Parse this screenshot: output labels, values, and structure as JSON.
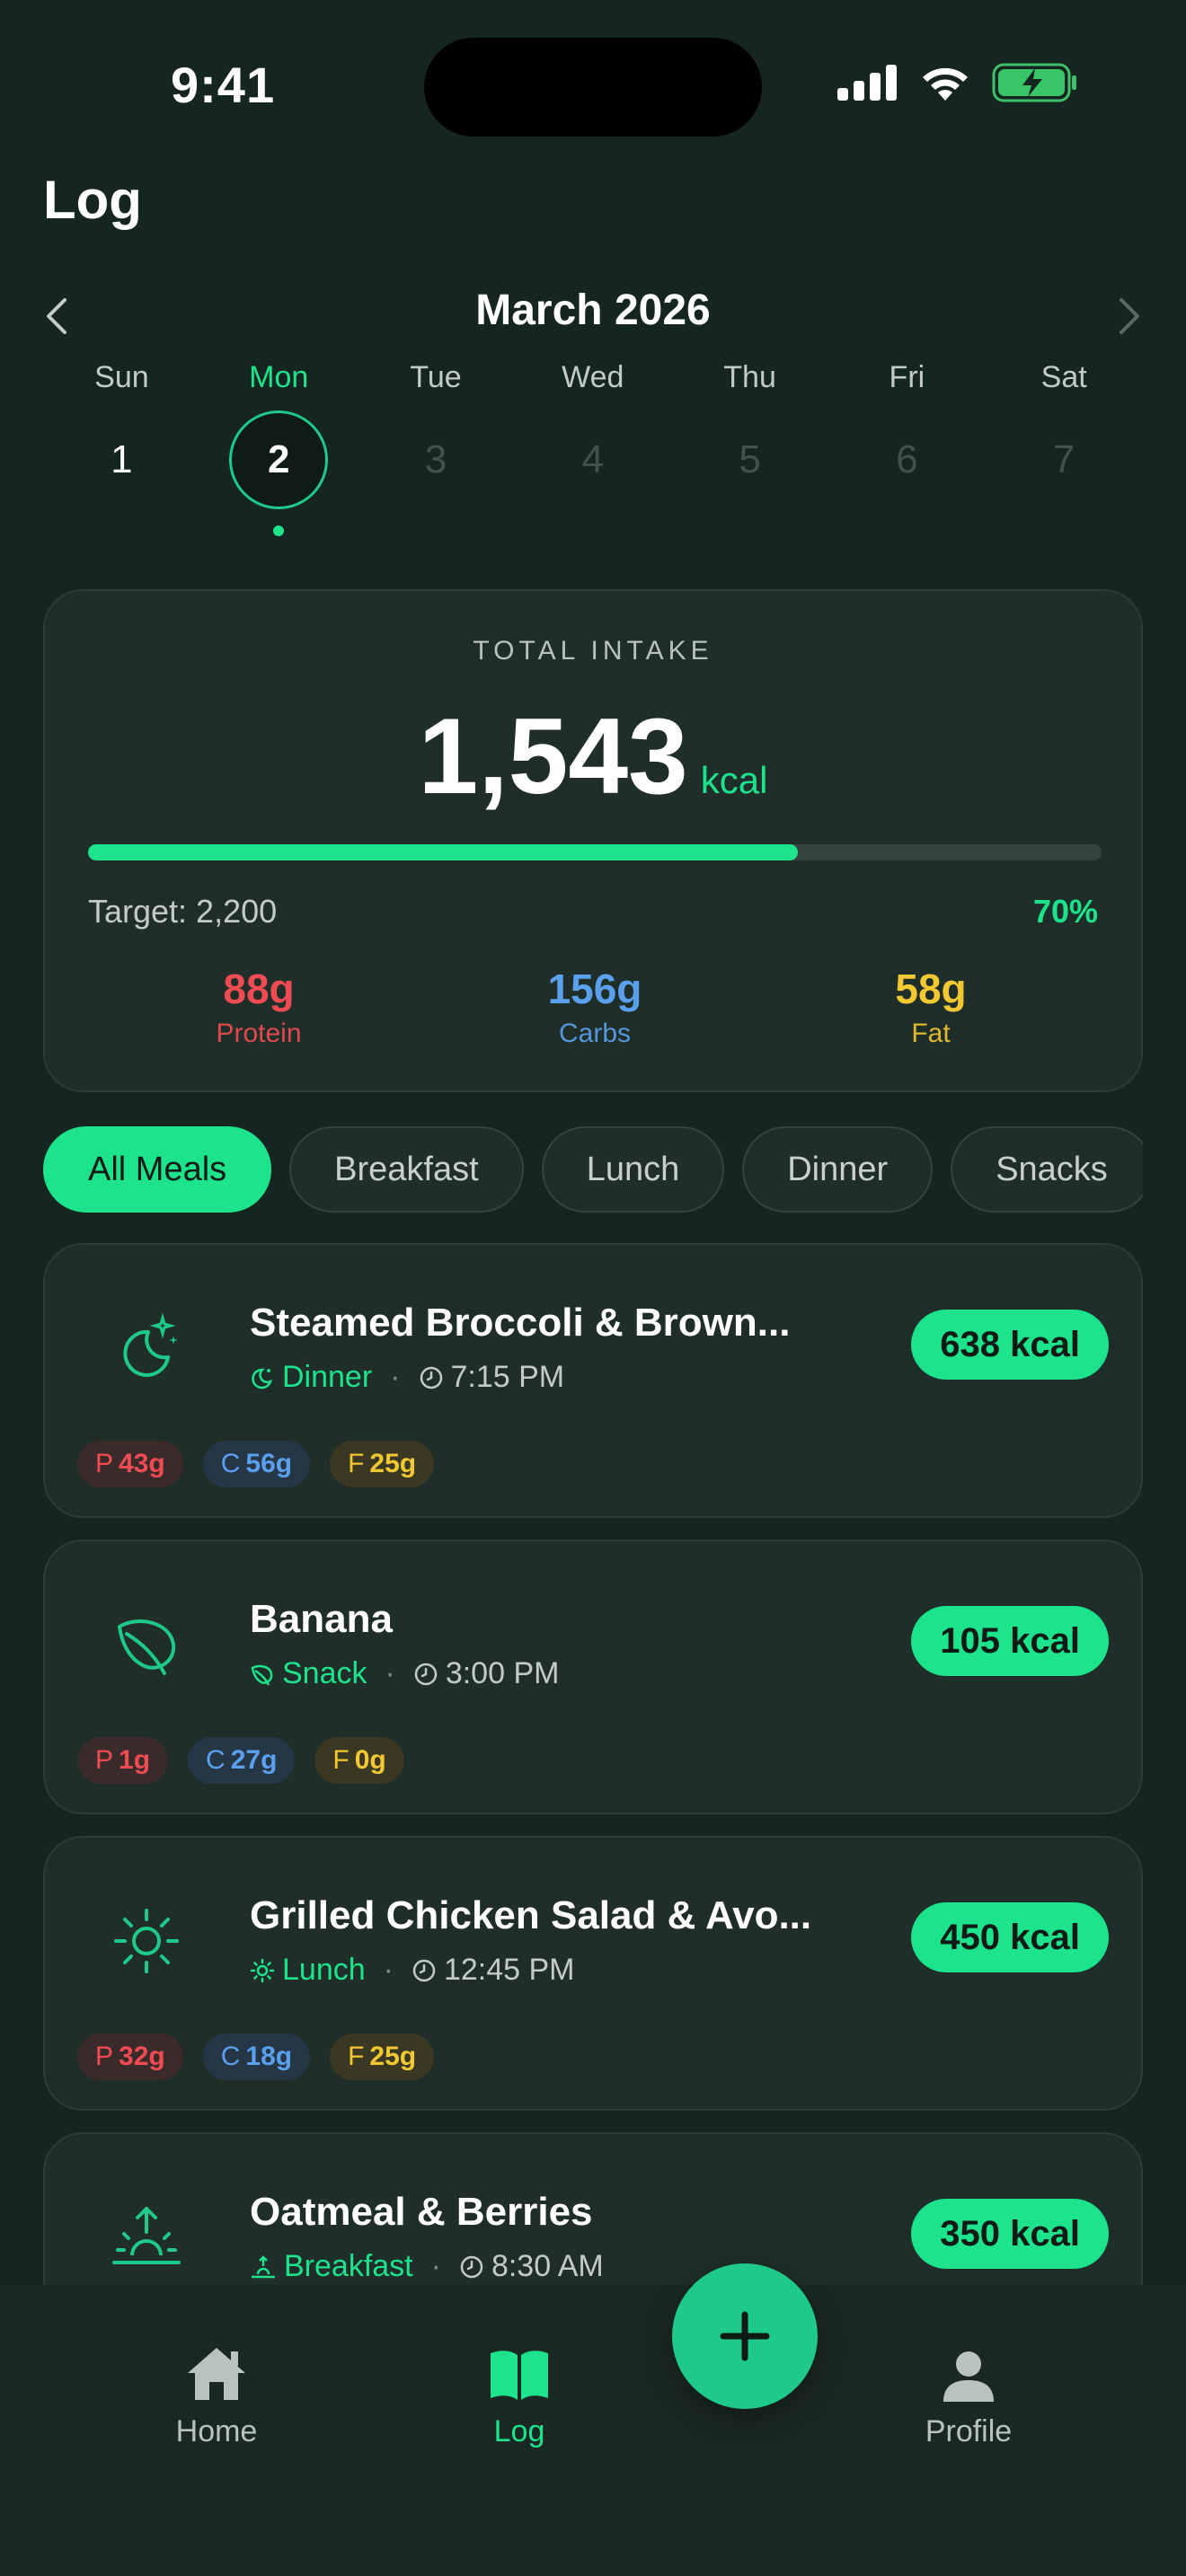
{
  "status_bar": {
    "time": "9:41"
  },
  "page": {
    "title": "Log"
  },
  "calendar": {
    "month": "March 2026",
    "days": [
      {
        "name": "Sun",
        "num": "1",
        "state": "past"
      },
      {
        "name": "Mon",
        "num": "2",
        "state": "selected"
      },
      {
        "name": "Tue",
        "num": "3",
        "state": "future"
      },
      {
        "name": "Wed",
        "num": "4",
        "state": "future"
      },
      {
        "name": "Thu",
        "num": "5",
        "state": "future"
      },
      {
        "name": "Fri",
        "num": "6",
        "state": "future"
      },
      {
        "name": "Sat",
        "num": "7",
        "state": "future"
      }
    ]
  },
  "summary": {
    "label": "TOTAL INTAKE",
    "value": "1,543",
    "unit": "kcal",
    "progress": 0.7,
    "target": "Target: 2,200",
    "percent": "70%",
    "macros": [
      {
        "value": "88g",
        "label": "Protein",
        "color": "#ef4b52"
      },
      {
        "value": "156g",
        "label": "Carbs",
        "color": "#5ba0ec"
      },
      {
        "value": "58g",
        "label": "Fat",
        "color": "#f2c832"
      }
    ]
  },
  "filters": [
    {
      "label": "All Meals",
      "active": true
    },
    {
      "label": "Breakfast",
      "active": false
    },
    {
      "label": "Lunch",
      "active": false
    },
    {
      "label": "Dinner",
      "active": false
    },
    {
      "label": "Snacks",
      "active": false
    }
  ],
  "meals": [
    {
      "name": "Steamed Broccoli & Brown...",
      "type": "Dinner",
      "icon": "moon-icon",
      "time": "7:15 PM",
      "kcal": "638 kcal",
      "protein": "43g",
      "carbs": "56g",
      "fat": "25g"
    },
    {
      "name": "Banana",
      "type": "Snack",
      "icon": "leaf-icon",
      "time": "3:00 PM",
      "kcal": "105 kcal",
      "protein": "1g",
      "carbs": "27g",
      "fat": "0g"
    },
    {
      "name": "Grilled Chicken Salad & Avo...",
      "type": "Lunch",
      "icon": "sun-icon",
      "time": "12:45 PM",
      "kcal": "450 kcal",
      "protein": "32g",
      "carbs": "18g",
      "fat": "25g"
    },
    {
      "name": "Oatmeal & Berries",
      "type": "Breakfast",
      "icon": "sunrise-icon",
      "time": "8:30 AM",
      "kcal": "350 kcal",
      "protein": "",
      "carbs": "",
      "fat": ""
    }
  ],
  "macro_letters": {
    "p": "P",
    "c": "C",
    "f": "F"
  },
  "tabs": {
    "home": "Home",
    "log": "Log",
    "profile": "Profile"
  },
  "colors": {
    "accent": "#1de38c",
    "background": "#15251f",
    "card": "#1f2e29"
  }
}
